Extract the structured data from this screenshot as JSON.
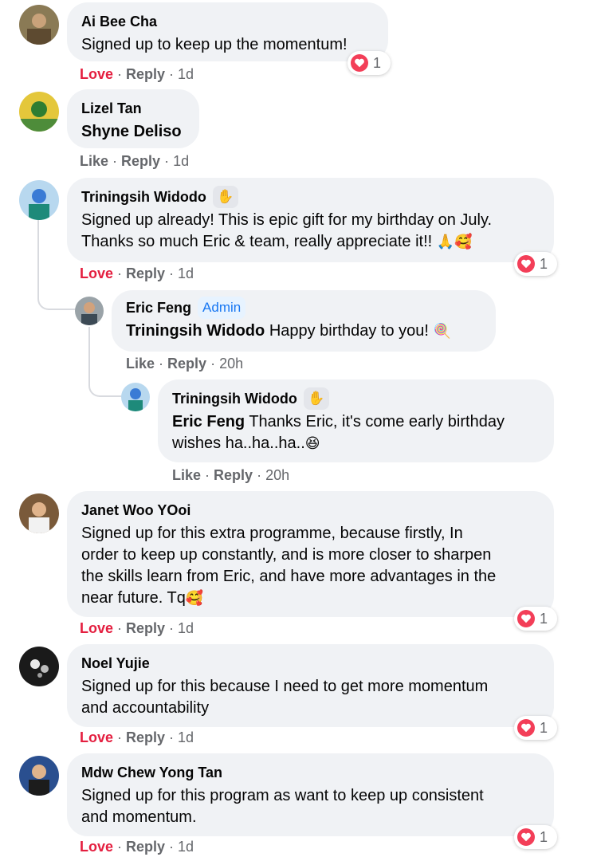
{
  "comments": [
    {
      "author": "Ai Bee Cha",
      "text": "Signed up to keep up the momentum!",
      "reaction_label": "Love",
      "reply": "Reply",
      "time": "1d",
      "reaction_count": "1"
    },
    {
      "author": "Lizel Tan",
      "tag": "Shyne Deliso",
      "reaction_label": "Like",
      "reply": "Reply",
      "time": "1d"
    },
    {
      "author": "Triningsih Widodo",
      "badge": "wave-icon",
      "text": "Signed up already! This is epic gift for my birthday on July.",
      "text2": "Thanks so much Eric & team, really appreciate it!!",
      "emoji": "🙏🥰",
      "reaction_label": "Love",
      "reply": "Reply",
      "time": "1d",
      "reaction_count": "1"
    },
    {
      "author": "Eric Feng",
      "admin": "Admin",
      "tag": "Triningsih Widodo",
      "text": "Happy birthday to you!",
      "emoji": "🍭",
      "reaction_label": "Like",
      "reply": "Reply",
      "time": "20h"
    },
    {
      "author": "Triningsih Widodo",
      "badge": "wave-icon",
      "tag": "Eric Feng",
      "text": "Thanks Eric, it's come early birthday",
      "text2": "wishes ha..ha..ha..",
      "emoji": "😆",
      "reaction_label": "Like",
      "reply": "Reply",
      "time": "20h"
    },
    {
      "author": "Janet Woo YOoi",
      "lines": [
        "Signed up for this extra programme, because firstly, In",
        "order to keep up constantly, and is more closer to sharpen",
        "the skills learn from Eric, and have more advantages in the",
        "near future. Tq"
      ],
      "emoji": "🥰",
      "reaction_label": "Love",
      "reply": "Reply",
      "time": "1d",
      "reaction_count": "1"
    },
    {
      "author": "Noel Yujie",
      "lines": [
        "Signed up for this because I need to get more momentum",
        "and accountability"
      ],
      "reaction_label": "Love",
      "reply": "Reply",
      "time": "1d",
      "reaction_count": "1"
    },
    {
      "author": "Mdw Chew Yong Tan",
      "lines": [
        "Signed up for this program as want to keep up consistent",
        "and momentum."
      ],
      "reaction_label": "Love",
      "reply": "Reply",
      "time": "1d",
      "reaction_count": "1"
    }
  ],
  "separator": "·",
  "colors": {
    "bubble": "#f0f2f5",
    "love": "#e41e3f",
    "meta": "#65676b",
    "admin": "#1877f2",
    "heart": "#f33e58"
  }
}
